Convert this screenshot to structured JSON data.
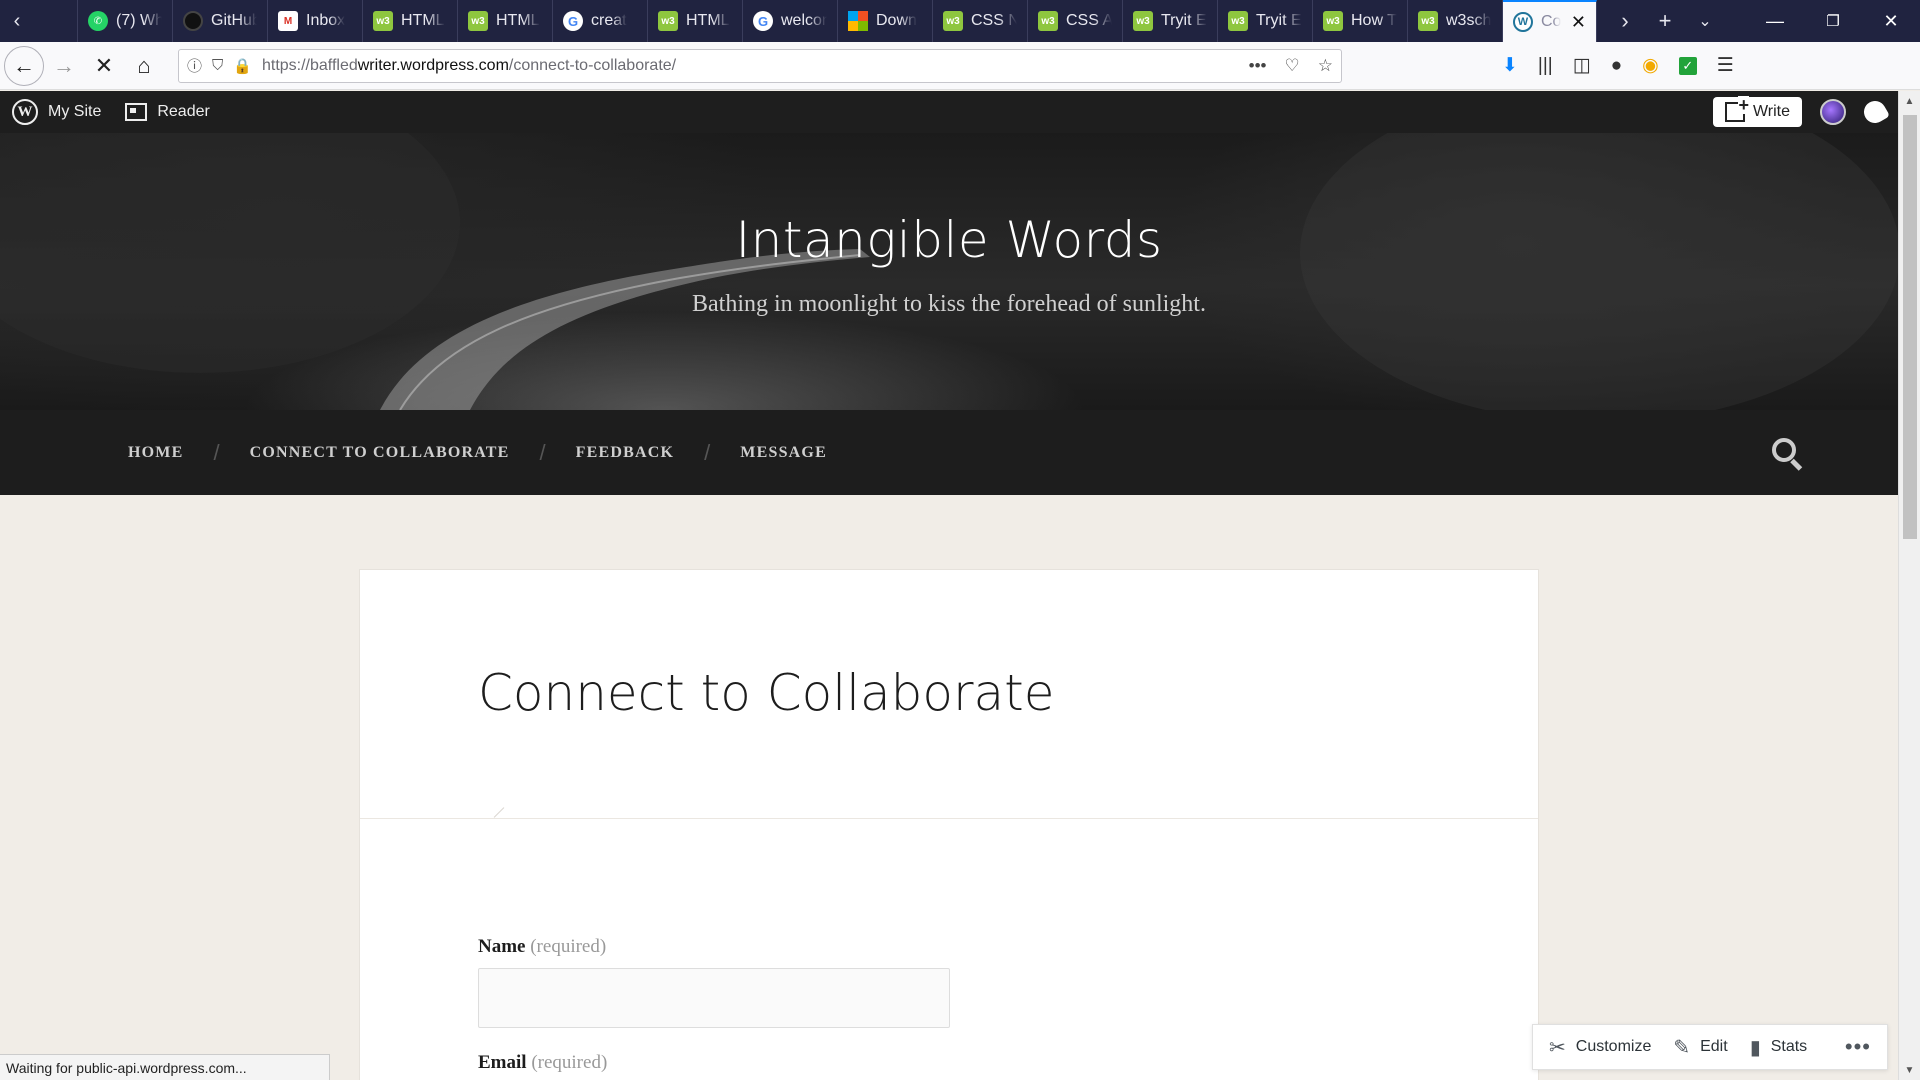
{
  "browser": {
    "tabs": [
      {
        "label": "(7) Wh",
        "icon": "whatsapp-icon"
      },
      {
        "label": "GitHub",
        "icon": "github-icon"
      },
      {
        "label": "Inbox",
        "icon": "gmail-icon"
      },
      {
        "label": "HTML",
        "icon": "w3schools-icon"
      },
      {
        "label": "HTML",
        "icon": "w3schools-icon"
      },
      {
        "label": "creat",
        "icon": "google-icon"
      },
      {
        "label": "HTML",
        "icon": "w3schools-icon"
      },
      {
        "label": "welcon",
        "icon": "google-icon"
      },
      {
        "label": "Down",
        "icon": "microsoft-icon"
      },
      {
        "label": "CSS N",
        "icon": "w3schools-icon"
      },
      {
        "label": "CSS A",
        "icon": "w3schools-icon"
      },
      {
        "label": "Tryit E",
        "icon": "w3schools-icon"
      },
      {
        "label": "Tryit E",
        "icon": "w3schools-icon"
      },
      {
        "label": "How T",
        "icon": "w3schools-icon"
      },
      {
        "label": "w3sch",
        "icon": "w3schools-icon"
      },
      {
        "label": "Co",
        "icon": "wordpress-icon",
        "active": true
      }
    ],
    "url_prefix": "https://baffled",
    "url_domain": "writer.wordpress.com",
    "url_path": "/connect-to-collaborate/"
  },
  "adminbar": {
    "my_site": "My Site",
    "reader": "Reader",
    "write": "Write"
  },
  "site": {
    "title": "Intangible Words",
    "description": "Bathing in moonlight to kiss the forehead of sunlight.",
    "menu": [
      "HOME",
      "CONNECT TO COLLABORATE",
      "FEEDBACK",
      "MESSAGE"
    ],
    "menu_separator": "/"
  },
  "page": {
    "title": "Connect to Collaborate",
    "name_label": "Name",
    "email_label": "Email",
    "required_text": "(required)"
  },
  "status": {
    "text": "Waiting for public-api.wordpress.com..."
  },
  "actions": {
    "customize": "Customize",
    "edit": "Edit",
    "stats": "Stats"
  },
  "colors": {
    "tabstrip": "#202340",
    "accent": "#0a84ff",
    "adminbar": "#1e1e1e",
    "sitenav": "#1d1d1d",
    "page_bg": "#f1ede7"
  }
}
